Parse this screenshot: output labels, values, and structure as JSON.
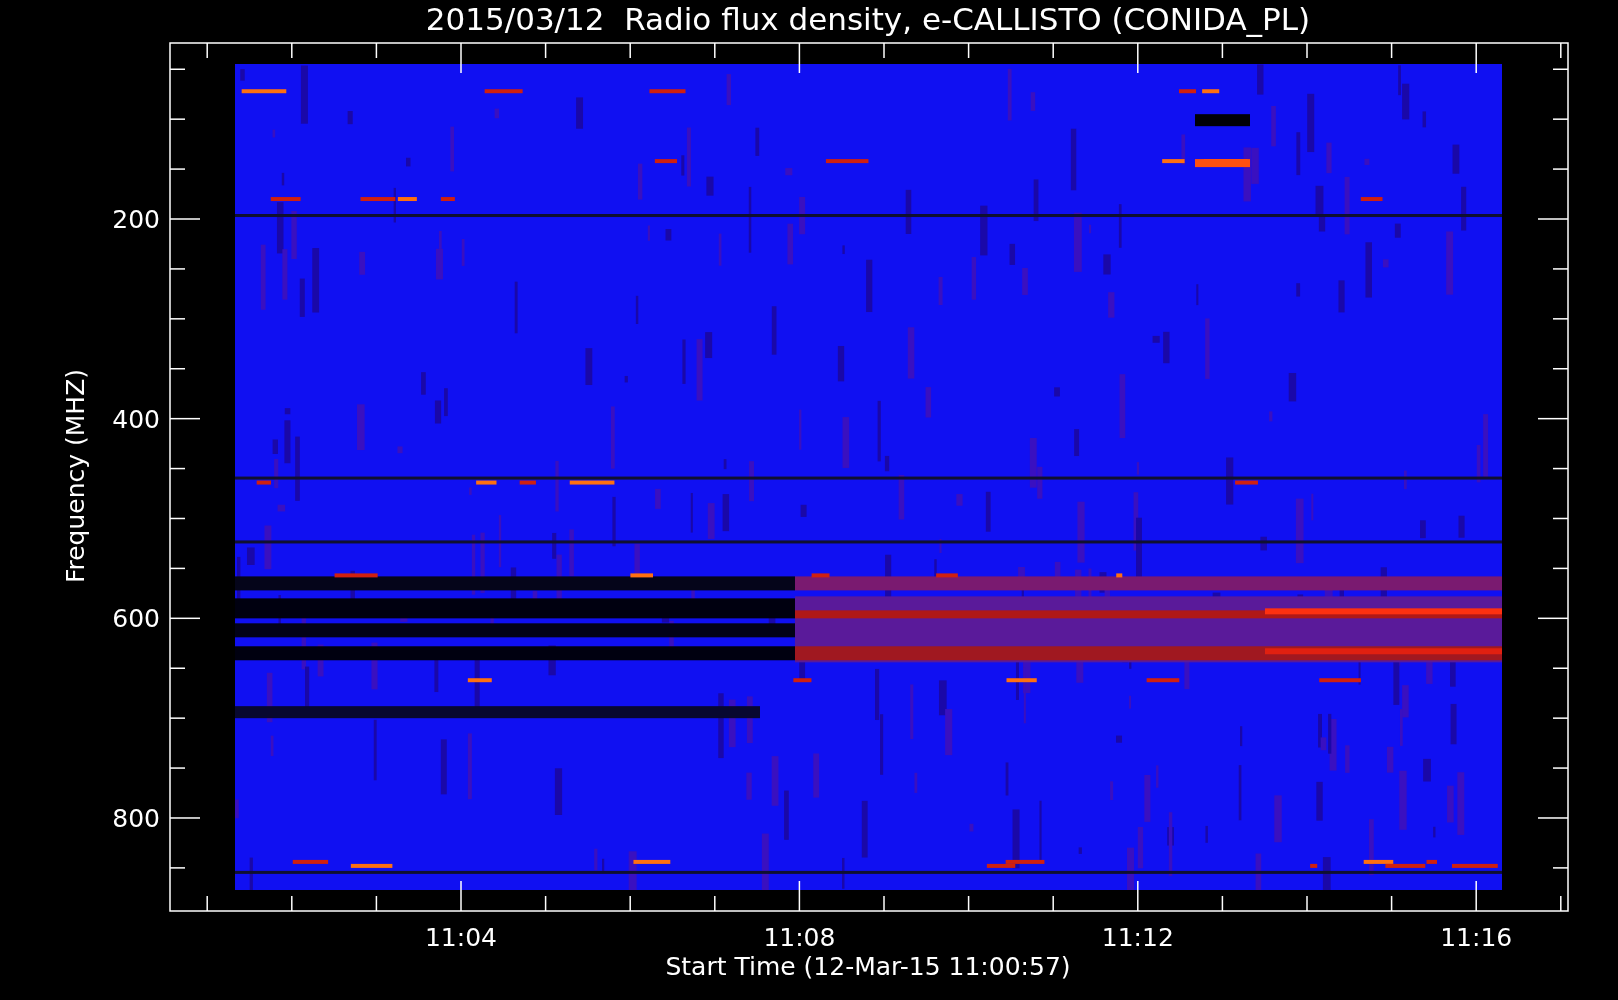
{
  "title": "2015/03/12  Radio flux density, e-CALLISTO (CONIDA_PL)",
  "y_axis": {
    "label": "Frequency (MHZ)",
    "ticks": [
      "200",
      "400",
      "600",
      "800"
    ]
  },
  "x_axis": {
    "label": "Start Time (12-Mar-15 11:00:57)",
    "ticks": [
      "11:04",
      "11:08",
      "11:12",
      "11:16"
    ]
  }
}
